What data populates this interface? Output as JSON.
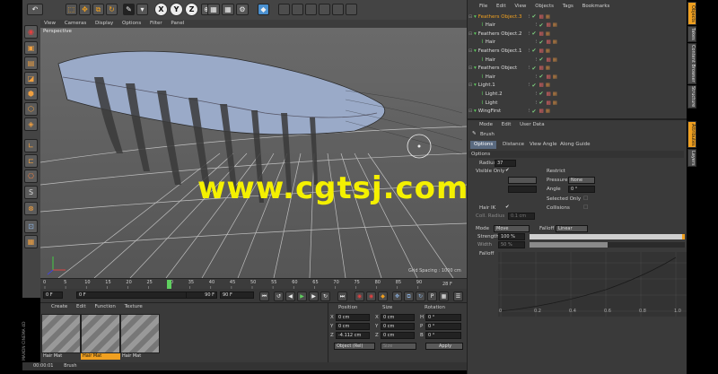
{
  "top_toolbar": {
    "axis_buttons": [
      "X",
      "Y",
      "Z"
    ]
  },
  "viewport": {
    "menu": [
      "View",
      "Cameras",
      "Display",
      "Options",
      "Filter",
      "Panel"
    ],
    "label": "Perspective",
    "grid_spacing": "Grid Spacing : 1000 cm"
  },
  "watermark": "www.cgtsj.com",
  "object_manager": {
    "menu": [
      "File",
      "Edit",
      "View",
      "Objects",
      "Tags",
      "Bookmarks"
    ],
    "objects": [
      {
        "name": "Feathers Object.3",
        "indent": 0,
        "selected": true
      },
      {
        "name": "Hair",
        "indent": 1,
        "selected": false
      },
      {
        "name": "Feathers Object.2",
        "indent": 0,
        "selected": false
      },
      {
        "name": "Hair",
        "indent": 1,
        "selected": false
      },
      {
        "name": "Feathers Object.1",
        "indent": 0,
        "selected": false
      },
      {
        "name": "Hair",
        "indent": 1,
        "selected": false
      },
      {
        "name": "Feathers Object",
        "indent": 0,
        "selected": false
      },
      {
        "name": "Hair",
        "indent": 1,
        "selected": false
      },
      {
        "name": "Light.1",
        "indent": 0,
        "selected": false
      },
      {
        "name": "Light.2",
        "indent": 1,
        "selected": false
      },
      {
        "name": "Light",
        "indent": 1,
        "selected": false
      },
      {
        "name": "WingFirst",
        "indent": 0,
        "selected": false
      }
    ]
  },
  "attributes": {
    "menu": [
      "Mode",
      "Edit",
      "User Data"
    ],
    "tool_name": "Brush",
    "tabs": [
      "Options",
      "Distance",
      "View Angle",
      "Along Guide"
    ],
    "section_title": "Options",
    "radius_label": "Radius",
    "radius_value": "37",
    "visible_only_label": "Visible Only",
    "restrict_label": "Restrict",
    "pressure_label": "Pressure",
    "pressure_value": "None",
    "angle_label": "Angle",
    "angle_value": "0 °",
    "selected_only_label": "Selected Only",
    "hair_ik_label": "Hair IK",
    "collisions_label": "Collisions",
    "coll_radius_label": "Coll. Radius",
    "coll_radius_value": "0.1 cm",
    "mode_label": "Mode",
    "mode_value": "Move",
    "falloff_label": "Falloff",
    "falloff_value": "Linear",
    "strength_label": "Strength",
    "strength_value": "100 %",
    "strength_fraction": 1.0,
    "width_label": "Width",
    "width_value": "50 %",
    "width_fraction": 0.5,
    "falloff_graph_label": "Falloff",
    "graph_x_ticks": [
      "0",
      "0.2",
      "0.4",
      "0.6",
      "0.8",
      "1.0"
    ]
  },
  "right_tabs": [
    "Objects",
    "Takes",
    "Content Browser",
    "Structure",
    "Attributes",
    "Layers"
  ],
  "timeline": {
    "ticks": [
      "0",
      "5",
      "10",
      "15",
      "20",
      "25",
      "30",
      "35",
      "40",
      "45",
      "50",
      "55",
      "60",
      "65",
      "70",
      "75",
      "80",
      "85",
      "90"
    ],
    "current_frame_label": "28 F",
    "start_frame": "0 F",
    "start_field": "0 F",
    "end_field": "90 F",
    "max_field": "90 F"
  },
  "material_manager": {
    "menu": [
      "Create",
      "Edit",
      "Function",
      "Texture"
    ],
    "materials": [
      {
        "name": "Hair Mat",
        "selected": false
      },
      {
        "name": "Hair Mat",
        "selected": true
      },
      {
        "name": "Hair Mat",
        "selected": false
      }
    ]
  },
  "coordinates": {
    "headers": [
      "Position",
      "Size",
      "Rotation"
    ],
    "rows": [
      {
        "axis": "X",
        "pos": "0 cm",
        "size_axis": "X",
        "size": "0 cm",
        "rot_axis": "H",
        "rot": "0 °"
      },
      {
        "axis": "Y",
        "pos": "0 cm",
        "size_axis": "Y",
        "size": "0 cm",
        "rot_axis": "P",
        "rot": "0 °"
      },
      {
        "axis": "Z",
        "pos": "-4.112 cm",
        "size_axis": "Z",
        "size": "0 cm",
        "rot_axis": "B",
        "rot": "0 °"
      }
    ],
    "mode_dropdown": "Object (Rel)",
    "size_dropdown": "Size",
    "apply_label": "Apply"
  },
  "status_bar": {
    "time": "00:00:01",
    "message": "Brush"
  },
  "brand_text": "MAXON CINEMA 4D",
  "colors": {
    "accent_orange": "#f0a020",
    "panel_bg": "#3a3a3a",
    "watermark_yellow": "#f4f000"
  }
}
